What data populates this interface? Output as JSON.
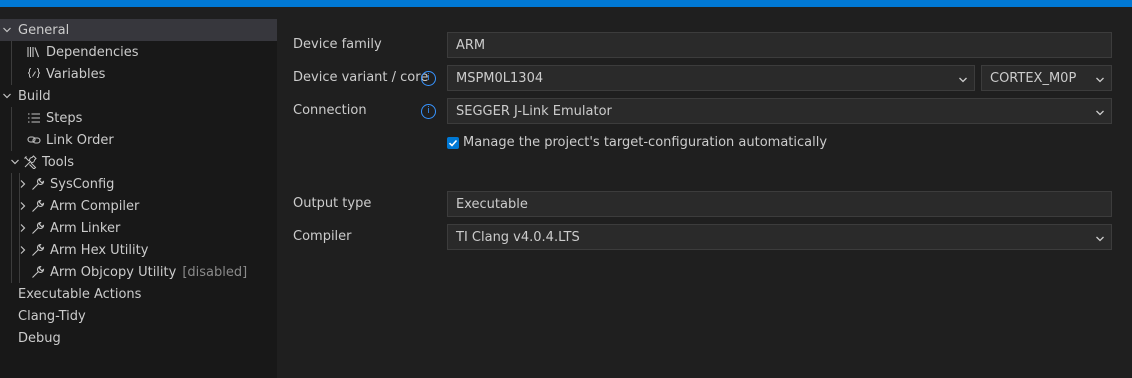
{
  "sidebar": {
    "items": [
      {
        "label": "General"
      },
      {
        "label": "Dependencies"
      },
      {
        "label": "Variables"
      },
      {
        "label": "Build"
      },
      {
        "label": "Steps"
      },
      {
        "label": "Link Order"
      },
      {
        "label": "Tools"
      },
      {
        "label": "SysConfig"
      },
      {
        "label": "Arm Compiler"
      },
      {
        "label": "Arm Linker"
      },
      {
        "label": "Arm Hex Utility"
      },
      {
        "label": "Arm Objcopy Utility",
        "note": "[disabled]"
      },
      {
        "label": "Executable Actions"
      },
      {
        "label": "Clang-Tidy"
      },
      {
        "label": "Debug"
      }
    ],
    "icons": {
      "dependencies": "library-icon",
      "variables": "variable-icon",
      "steps": "list-icon",
      "link_order": "link-icon",
      "tools": "tools-icon",
      "tool_item": "wrench-icon"
    }
  },
  "form": {
    "device_family": {
      "label": "Device family",
      "value": "ARM"
    },
    "device_variant": {
      "label": "Device variant / core",
      "value": "MSPM0L1304",
      "core_value": "CORTEX_M0P"
    },
    "connection": {
      "label": "Connection",
      "value": "SEGGER J-Link Emulator"
    },
    "manage_config": {
      "label": "Manage the project's target-configuration automatically",
      "checked": true
    },
    "output_type": {
      "label": "Output type",
      "value": "Executable"
    },
    "compiler": {
      "label": "Compiler",
      "value": "TI Clang v4.0.4.LTS"
    },
    "info_glyph": "i"
  },
  "colors": {
    "accent": "#0078d4",
    "info": "#3794ff",
    "selected_row": "#37373d"
  }
}
